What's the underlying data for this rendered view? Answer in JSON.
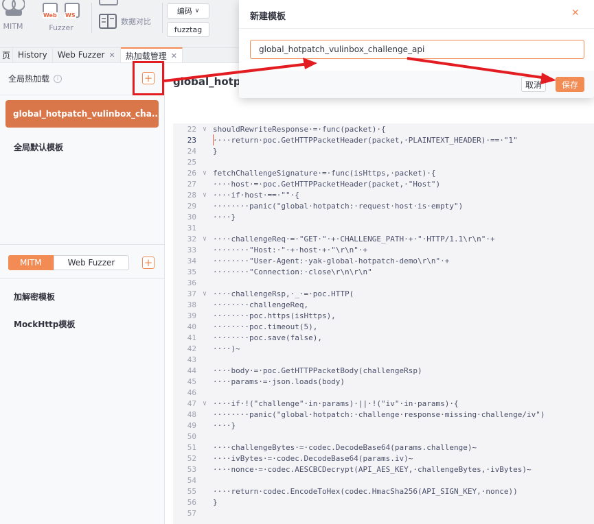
{
  "toolbar": {
    "mitm_label": "MITM",
    "fuzzer_label": "Fuzzer",
    "web_tag": "Web",
    "ws_tag": "WS",
    "data_compare_label": "数据对比",
    "encode_label": "编码",
    "fuzztag_label": "fuzztag"
  },
  "tabs": [
    {
      "label": "页"
    },
    {
      "label": "History"
    },
    {
      "label": "Web Fuzzer"
    },
    {
      "label": "热加载管理"
    }
  ],
  "left": {
    "header": "全局热加载",
    "active_template": "global_hotpatch_vulinbox_cha...",
    "default_template": "全局默认模板",
    "seg_mitm": "MITM",
    "seg_webfuzzer": "Web Fuzzer",
    "codec_template": "加解密模板",
    "mockhttp_template": "MockHttp模板"
  },
  "main": {
    "title": "global_hotpat"
  },
  "editor": {
    "current_line": 23,
    "lines": [
      {
        "n": "22",
        "fold": "∨",
        "code": "shouldRewriteResponse·=·func(packet)·{"
      },
      {
        "n": "23",
        "fold": "",
        "code": "····return·poc.GetHTTPPacketHeader(packet,·PLAINTEXT_HEADER)·==·\"1\""
      },
      {
        "n": "24",
        "fold": "",
        "code": "}"
      },
      {
        "n": "25",
        "fold": "",
        "code": ""
      },
      {
        "n": "26",
        "fold": "∨",
        "code": "fetchChallengeSignature·=·func(isHttps,·packet)·{"
      },
      {
        "n": "27",
        "fold": "",
        "code": "····host·=·poc.GetHTTPPacketHeader(packet,·\"Host\")"
      },
      {
        "n": "28",
        "fold": "∨",
        "code": "····if·host·==·\"\"·{"
      },
      {
        "n": "29",
        "fold": "",
        "code": "········panic(\"global·hotpatch:·request·host·is·empty\")"
      },
      {
        "n": "30",
        "fold": "",
        "code": "····}"
      },
      {
        "n": "31",
        "fold": "",
        "code": ""
      },
      {
        "n": "32",
        "fold": "∨",
        "code": "····challengeReq·=·\"GET·\"·+·CHALLENGE_PATH·+·\"·HTTP/1.1\\r\\n\"·+"
      },
      {
        "n": "33",
        "fold": "",
        "code": "········\"Host:·\"·+·host·+·\"\\r\\n\"·+"
      },
      {
        "n": "34",
        "fold": "",
        "code": "········\"User-Agent:·yak-global-hotpatch-demo\\r\\n\"·+"
      },
      {
        "n": "35",
        "fold": "",
        "code": "········\"Connection:·close\\r\\n\\r\\n\""
      },
      {
        "n": "36",
        "fold": "",
        "code": ""
      },
      {
        "n": "37",
        "fold": "∨",
        "code": "····challengeRsp,·_·=·poc.HTTP("
      },
      {
        "n": "38",
        "fold": "",
        "code": "········challengeReq,"
      },
      {
        "n": "39",
        "fold": "",
        "code": "········poc.https(isHttps),"
      },
      {
        "n": "40",
        "fold": "",
        "code": "········poc.timeout(5),"
      },
      {
        "n": "41",
        "fold": "",
        "code": "········poc.save(false),"
      },
      {
        "n": "42",
        "fold": "",
        "code": "····)~"
      },
      {
        "n": "43",
        "fold": "",
        "code": ""
      },
      {
        "n": "44",
        "fold": "",
        "code": "····body·=·poc.GetHTTPPacketBody(challengeRsp)"
      },
      {
        "n": "45",
        "fold": "",
        "code": "····params·=·json.loads(body)"
      },
      {
        "n": "46",
        "fold": "",
        "code": ""
      },
      {
        "n": "47",
        "fold": "∨",
        "code": "····if·!(\"challenge\"·in·params)·||·!(\"iv\"·in·params)·{"
      },
      {
        "n": "48",
        "fold": "",
        "code": "········panic(\"global·hotpatch:·challenge·response·missing·challenge/iv\")"
      },
      {
        "n": "49",
        "fold": "",
        "code": "····}"
      },
      {
        "n": "50",
        "fold": "",
        "code": ""
      },
      {
        "n": "51",
        "fold": "",
        "code": "····challengeBytes·=·codec.DecodeBase64(params.challenge)~"
      },
      {
        "n": "52",
        "fold": "",
        "code": "····ivBytes·=·codec.DecodeBase64(params.iv)~"
      },
      {
        "n": "53",
        "fold": "",
        "code": "····nonce·=·codec.AESCBCDecrypt(API_AES_KEY,·challengeBytes,·ivBytes)~"
      },
      {
        "n": "54",
        "fold": "",
        "code": ""
      },
      {
        "n": "55",
        "fold": "",
        "code": "····return·codec.EncodeToHex(codec.HmacSha256(API_SIGN_KEY,·nonce))"
      },
      {
        "n": "56",
        "fold": "",
        "code": "}"
      },
      {
        "n": "57",
        "fold": "",
        "code": ""
      }
    ]
  },
  "modal": {
    "title": "新建模板",
    "input_value": "global_hotpatch_vulinbox_challenge_api",
    "cancel_label": "取消",
    "save_label": "保存"
  },
  "icons": {
    "close": "close-icon",
    "info": "info-icon",
    "plus": "plus-icon",
    "kebab": "more-vertical-icon"
  },
  "colors": {
    "accent": "#f28b54",
    "active_item": "#d9774a",
    "annotation_red": "#e31c22"
  }
}
